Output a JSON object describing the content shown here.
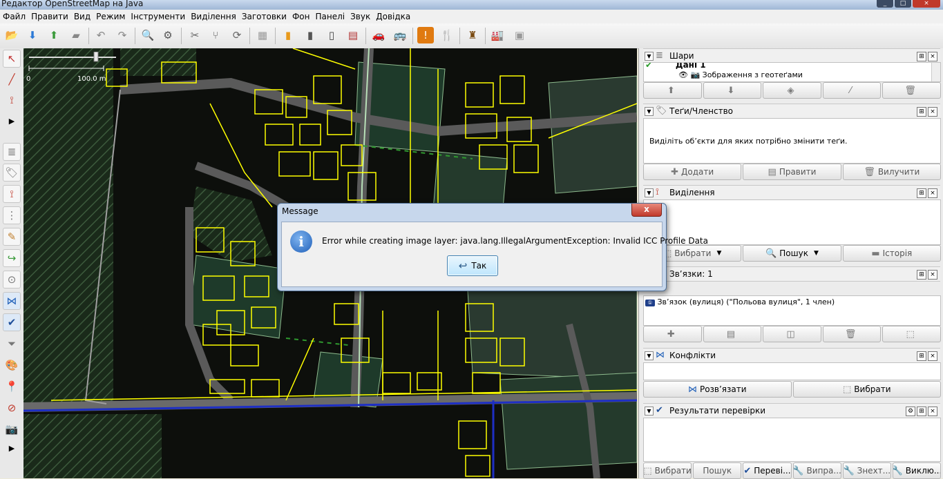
{
  "window": {
    "title": "Редактор OpenStreetMap на Java"
  },
  "menu": [
    "Файл",
    "Правити",
    "Вид",
    "Режим",
    "Інструменти",
    "Виділення",
    "Заготовки",
    "Фон",
    "Панелі",
    "Звук",
    "Довідка"
  ],
  "toolbar": {
    "icons": [
      "open-icon",
      "download-icon",
      "upload-icon",
      "save-icon",
      "undo-icon",
      "redo-icon",
      "zoom-icon",
      "preferences-icon",
      "split-way-icon",
      "combine-icon",
      "refresh-icon",
      "grid-icon",
      "highway-icon",
      "street-icon",
      "railway-icon",
      "wall-icon",
      "car-icon",
      "bus-icon",
      "warning-icon",
      "food-icon",
      "castle-icon",
      "factory-icon",
      "building-icon"
    ]
  },
  "map": {
    "scale_label_start": "0",
    "scale_label_end": "100.0 m"
  },
  "panels": {
    "layers": {
      "title": "Шари",
      "items": [
        "Дані 1",
        "Зображення з геотеґами"
      ],
      "buttons": [
        "move-up",
        "move-down",
        "merge",
        "toggle-visible",
        "delete"
      ]
    },
    "tags": {
      "title": "Теґи/Членство",
      "empty_message": "Виділіть об’єкти для яких потрібно змінити теґи.",
      "buttons": [
        "Додати",
        "Правити",
        "Вилучити"
      ]
    },
    "selection": {
      "title": "Виділення",
      "buttons": [
        "Вибрати",
        "Пошук",
        "Історія"
      ]
    },
    "relations": {
      "title": "Зв’язки: 1",
      "items": [
        "Зв’язок (вулиця) (\"Польова вулиця\", 1 член)"
      ]
    },
    "conflicts": {
      "title": "Конфлікти",
      "buttons": [
        "Розв’язати",
        "Вибрати"
      ]
    },
    "validation": {
      "title": "Результати перевірки",
      "buttons": [
        "Вибрати",
        "Пошук",
        "Переві...",
        "Випра...",
        "Знехт...",
        "Виклю..."
      ]
    }
  },
  "dialog": {
    "title": "Message",
    "close_label": "x",
    "message": "Error while creating image layer: java.lang.IllegalArgumentException: Invalid ICC Profile Data",
    "ok_label": "Так"
  },
  "colors": {
    "map_bg": "#0d0f0c",
    "way_yellow": "#ffff00",
    "road_gray": "#606060",
    "dialog_frame": "#c7d7ec"
  }
}
